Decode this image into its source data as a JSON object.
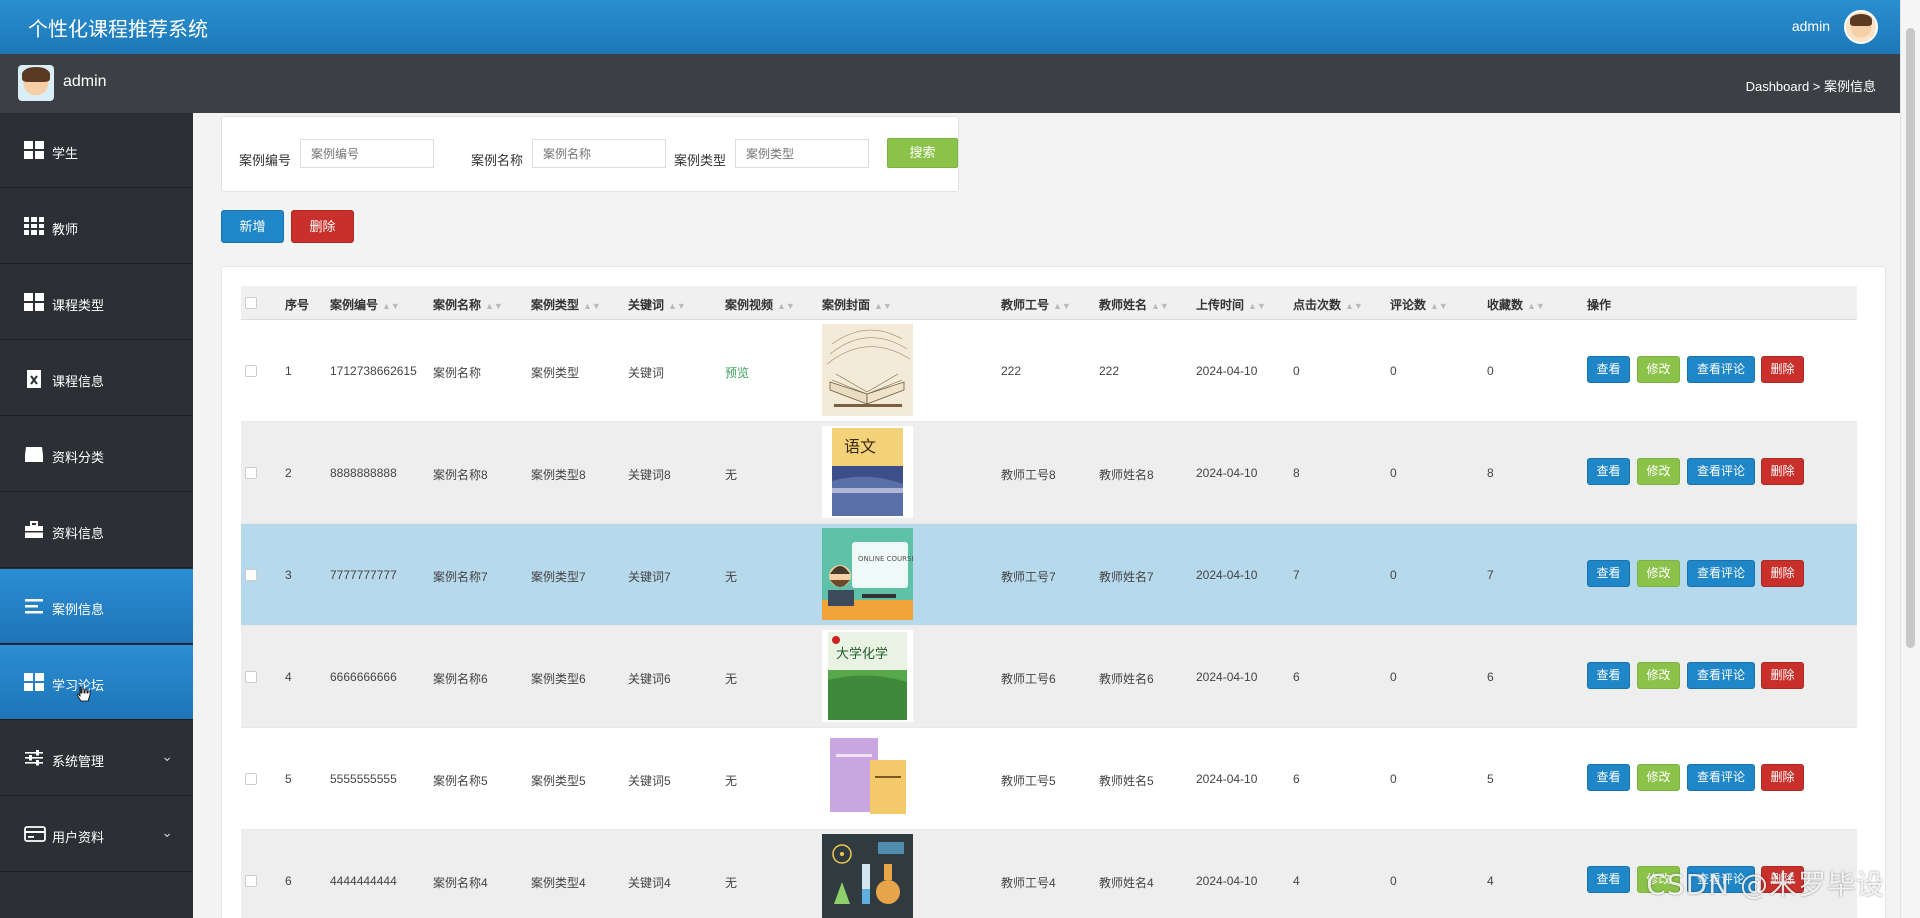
{
  "app": {
    "title": "个性化课程推荐系统",
    "user": "admin"
  },
  "subbar": {
    "username": "admin",
    "breadcrumb": "Dashboard > 案例信息"
  },
  "sidebar": {
    "items": [
      {
        "label": "学生",
        "icon": "grid-icon",
        "active": false
      },
      {
        "label": "教师",
        "icon": "grid9-icon",
        "active": false
      },
      {
        "label": "课程类型",
        "icon": "grid-icon",
        "active": false
      },
      {
        "label": "课程信息",
        "icon": "document-x-icon",
        "active": false
      },
      {
        "label": "资料分类",
        "icon": "inbox-icon",
        "active": false
      },
      {
        "label": "资料信息",
        "icon": "briefcase-icon",
        "active": false
      },
      {
        "label": "案例信息",
        "icon": "list-icon",
        "active": true
      },
      {
        "label": "学习论坛",
        "icon": "grid-icon",
        "active": true
      },
      {
        "label": "系统管理",
        "icon": "sliders-icon",
        "active": false,
        "chevron": "⌄"
      },
      {
        "label": "用户资料",
        "icon": "card-icon",
        "active": false,
        "chevron": "⌄"
      }
    ]
  },
  "search": {
    "fields": [
      {
        "label": "案例编号",
        "placeholder": "案例编号"
      },
      {
        "label": "案例名称",
        "placeholder": "案例名称"
      },
      {
        "label": "案例类型",
        "placeholder": "案例类型"
      }
    ],
    "button": "搜索"
  },
  "toolbar": {
    "add": "新增",
    "delete": "删除"
  },
  "table": {
    "headers": [
      "序号",
      "案例编号",
      "案例名称",
      "案例类型",
      "关键词",
      "案例视频",
      "案例封面",
      "教师工号",
      "教师姓名",
      "上传时间",
      "点击次数",
      "评论数",
      "收藏数",
      "操作"
    ],
    "actions": {
      "view": "查看",
      "edit": "修改",
      "comments": "查看评论",
      "delete": "删除"
    },
    "rows": [
      {
        "no": "1",
        "code": "1712738662615",
        "name": "案例名称",
        "type": "案例类型",
        "keyword": "关键词",
        "video": "预览",
        "cover": "open-book",
        "teacher_id": "222",
        "teacher_name": "222",
        "time": "2024-04-10",
        "clicks": "0",
        "comments": "0",
        "favorites": "0"
      },
      {
        "no": "2",
        "code": "8888888888",
        "name": "案例名称8",
        "type": "案例类型8",
        "keyword": "关键词8",
        "video": "无",
        "cover": "chinese-book",
        "teacher_id": "教师工号8",
        "teacher_name": "教师姓名8",
        "time": "2024-04-10",
        "clicks": "8",
        "comments": "0",
        "favorites": "8"
      },
      {
        "no": "3",
        "code": "7777777777",
        "name": "案例名称7",
        "type": "案例类型7",
        "keyword": "关键词7",
        "video": "无",
        "cover": "online-course",
        "teacher_id": "教师工号7",
        "teacher_name": "教师姓名7",
        "time": "2024-04-10",
        "clicks": "7",
        "comments": "0",
        "favorites": "7"
      },
      {
        "no": "4",
        "code": "6666666666",
        "name": "案例名称6",
        "type": "案例类型6",
        "keyword": "关键词6",
        "video": "无",
        "cover": "chemistry-book",
        "teacher_id": "教师工号6",
        "teacher_name": "教师姓名6",
        "time": "2024-04-10",
        "clicks": "6",
        "comments": "0",
        "favorites": "6"
      },
      {
        "no": "5",
        "code": "5555555555",
        "name": "案例名称5",
        "type": "案例类型5",
        "keyword": "关键词5",
        "video": "无",
        "cover": "two-books",
        "teacher_id": "教师工号5",
        "teacher_name": "教师姓名5",
        "time": "2024-04-10",
        "clicks": "6",
        "comments": "0",
        "favorites": "5"
      },
      {
        "no": "6",
        "code": "4444444444",
        "name": "案例名称4",
        "type": "案例类型4",
        "keyword": "关键词4",
        "video": "无",
        "cover": "science-poster",
        "teacher_id": "教师工号4",
        "teacher_name": "教师姓名4",
        "time": "2024-04-10",
        "clicks": "4",
        "comments": "0",
        "favorites": "4"
      }
    ]
  },
  "cover_text": {
    "online_course": "ONLINE COURSE",
    "chinese": "语文",
    "chemistry": "大学化学"
  },
  "watermark": "CSDN @米罗毕设",
  "colors": {
    "primary": "#1f86c7",
    "success": "#8bc34a",
    "danger": "#c9302c",
    "sidebar": "#2c2f33",
    "highlight_row": "#b6d9ec"
  }
}
